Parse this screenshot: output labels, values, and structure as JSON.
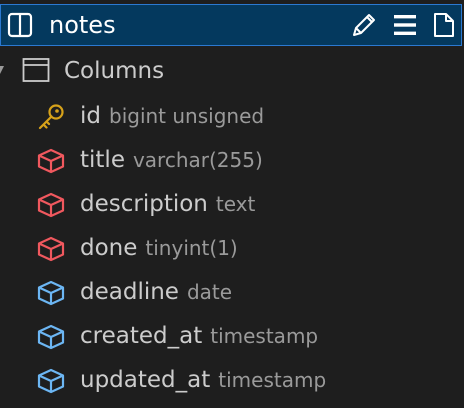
{
  "header": {
    "title": "notes"
  },
  "section": {
    "label": "Columns"
  },
  "columns": [
    {
      "name": "id",
      "type": "bigint unsigned",
      "icon": "key-icon"
    },
    {
      "name": "title",
      "type": "varchar(255)",
      "icon": "cube-icon-red"
    },
    {
      "name": "description",
      "type": "text",
      "icon": "cube-icon-red"
    },
    {
      "name": "done",
      "type": "tinyint(1)",
      "icon": "cube-icon-red"
    },
    {
      "name": "deadline",
      "type": "date",
      "icon": "cube-icon-blue"
    },
    {
      "name": "created_at",
      "type": "timestamp",
      "icon": "cube-icon-blue"
    },
    {
      "name": "updated_at",
      "type": "timestamp",
      "icon": "cube-icon-blue"
    }
  ],
  "colors": {
    "header_bg": "#04395e",
    "header_border": "#2b79d1",
    "key": "#d7a21a",
    "required": "#f0585e",
    "nullable": "#6cb6f3"
  }
}
